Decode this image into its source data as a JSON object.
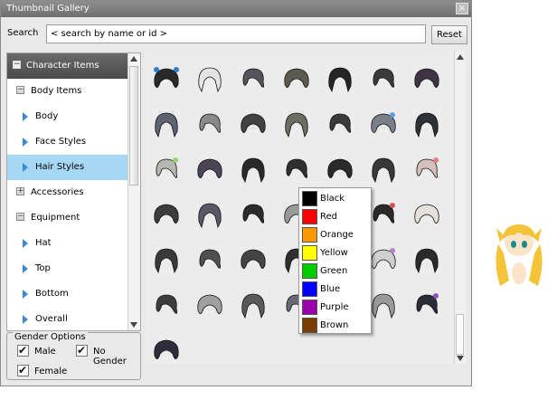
{
  "window": {
    "title": "Thumbnail Gallery",
    "close_label": "×"
  },
  "search": {
    "label": "Search",
    "value": "< search by name or id >",
    "reset_label": "Reset"
  },
  "tree": {
    "items": [
      {
        "label": "Character Items",
        "level": 0,
        "icon": "minus-box-icon",
        "state": "root"
      },
      {
        "label": "Body Items",
        "level": 1,
        "icon": "minus-box-icon"
      },
      {
        "label": "Body",
        "level": 2,
        "icon": "triangle-right-icon"
      },
      {
        "label": "Face Styles",
        "level": 2,
        "icon": "triangle-right-icon"
      },
      {
        "label": "Hair Styles",
        "level": 2,
        "icon": "triangle-right-icon",
        "state": "selected"
      },
      {
        "label": "Accessories",
        "level": 1,
        "icon": "plus-box-icon"
      },
      {
        "label": "Equipment",
        "level": 1,
        "icon": "minus-box-icon"
      },
      {
        "label": "Hat",
        "level": 2,
        "icon": "triangle-right-icon"
      },
      {
        "label": "Top",
        "level": 2,
        "icon": "triangle-right-icon"
      },
      {
        "label": "Bottom",
        "level": 2,
        "icon": "triangle-right-icon"
      },
      {
        "label": "Overall",
        "level": 2,
        "icon": "triangle-right-icon"
      }
    ]
  },
  "gender": {
    "title": "Gender Options",
    "options": [
      {
        "label": "Male",
        "checked": true
      },
      {
        "label": "No Gender",
        "checked": true
      },
      {
        "label": "Female",
        "checked": true
      }
    ]
  },
  "color_menu": {
    "items": [
      {
        "label": "Black",
        "color": "#000000"
      },
      {
        "label": "Red",
        "color": "#ff0000"
      },
      {
        "label": "Orange",
        "color": "#ff9900"
      },
      {
        "label": "Yellow",
        "color": "#ffff00"
      },
      {
        "label": "Green",
        "color": "#00cc00"
      },
      {
        "label": "Blue",
        "color": "#0000ff"
      },
      {
        "label": "Purple",
        "color": "#9900aa"
      },
      {
        "label": "Brown",
        "color": "#7a3d00"
      }
    ]
  },
  "gallery": {
    "hairstyles": [
      {
        "color": "#2a2a2a",
        "accent": "#2a7fd0"
      },
      {
        "color": "#e4e4e4",
        "accent": ""
      },
      {
        "color": "#55535c",
        "accent": ""
      },
      {
        "color": "#5c5a4e",
        "accent": ""
      },
      {
        "color": "#262626",
        "accent": ""
      },
      {
        "color": "#3a3a3a",
        "accent": ""
      },
      {
        "color": "#3d3545",
        "accent": ""
      },
      {
        "color": "#5d6470",
        "accent": ""
      },
      {
        "color": "#8a8a8a",
        "accent": ""
      },
      {
        "color": "#424242",
        "accent": ""
      },
      {
        "color": "#6b6d62",
        "accent": ""
      },
      {
        "color": "#3a3a3a",
        "accent": ""
      },
      {
        "color": "#7b8088",
        "accent": "#5aa0e0"
      },
      {
        "color": "#2d3135",
        "accent": ""
      },
      {
        "color": "#b5b8b0",
        "accent": "#9ad070"
      },
      {
        "color": "#4c4654",
        "accent": ""
      },
      {
        "color": "#2a2a2a",
        "accent": ""
      },
      {
        "color": "#303030",
        "accent": ""
      },
      {
        "color": "#2a2a2a",
        "accent": ""
      },
      {
        "color": "#383838",
        "accent": ""
      },
      {
        "color": "#d6c0bc",
        "accent": "#e08080"
      },
      {
        "color": "#3c3c3c",
        "accent": ""
      },
      {
        "color": "#5a5866",
        "accent": ""
      },
      {
        "color": "#2c2c2c",
        "accent": ""
      },
      {
        "color": "#9a9a9a",
        "accent": ""
      },
      {
        "color": "#3a3a3a",
        "accent": ""
      },
      {
        "color": "#2a2a2a",
        "accent": "#e05050"
      },
      {
        "color": "#e6e0da",
        "accent": ""
      },
      {
        "color": "#3a3a3a",
        "accent": ""
      },
      {
        "color": "#505050",
        "accent": ""
      },
      {
        "color": "#444444",
        "accent": ""
      },
      {
        "color": "#2f2f2f",
        "accent": ""
      },
      {
        "color": "#3c3c3c",
        "accent": ""
      },
      {
        "color": "#cfcfcf",
        "accent": "#b080d0"
      },
      {
        "color": "#2a2a2a",
        "accent": ""
      },
      {
        "color": "#3d3d3d",
        "accent": ""
      },
      {
        "color": "#a0a0a0",
        "accent": ""
      },
      {
        "color": "#5a5a5a",
        "accent": ""
      },
      {
        "color": "#6a6a75",
        "accent": ""
      },
      {
        "color": "#3a3a3a",
        "accent": ""
      },
      {
        "color": "#9a9a9a",
        "accent": ""
      },
      {
        "color": "#2a2e3a",
        "accent": "#9050c0"
      },
      {
        "color": "#2e2e3a",
        "accent": ""
      }
    ]
  },
  "character": {
    "hair_color": "#f3c33a",
    "skin_color": "#fde3c8"
  }
}
